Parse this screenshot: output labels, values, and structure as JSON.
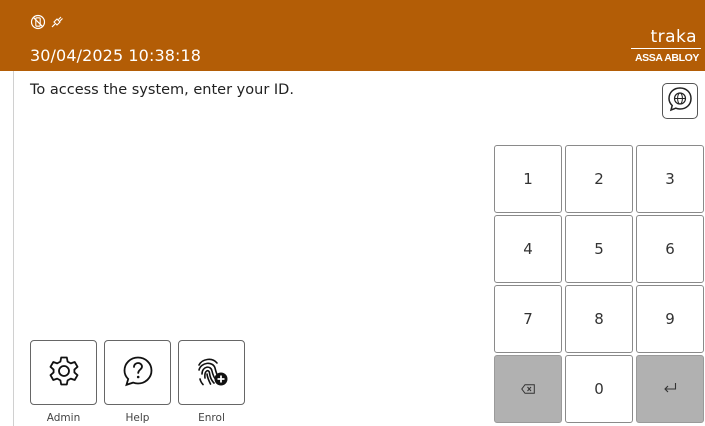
{
  "header": {
    "datetime": "30/04/2025 10:38:18",
    "logo_word": "traka",
    "logo_sub": "ASSA ABLOY",
    "status_icons": [
      "no-phone-icon",
      "unplugged-icon"
    ]
  },
  "main": {
    "prompt": "To access the system, enter your ID.",
    "language_icon": "globe-speech-icon"
  },
  "keypad": {
    "keys": [
      "1",
      "2",
      "3",
      "4",
      "5",
      "6",
      "7",
      "8",
      "9"
    ],
    "zero": "0",
    "backspace_icon": "backspace-icon",
    "enter_icon": "enter-icon"
  },
  "actions": [
    {
      "label": "Admin",
      "icon": "gear-icon"
    },
    {
      "label": "Help",
      "icon": "help-icon"
    },
    {
      "label": "Enrol",
      "icon": "fingerprint-add-icon"
    }
  ],
  "colors": {
    "header_bg": "#b35d06",
    "key_grey": "#b1b1b1"
  }
}
